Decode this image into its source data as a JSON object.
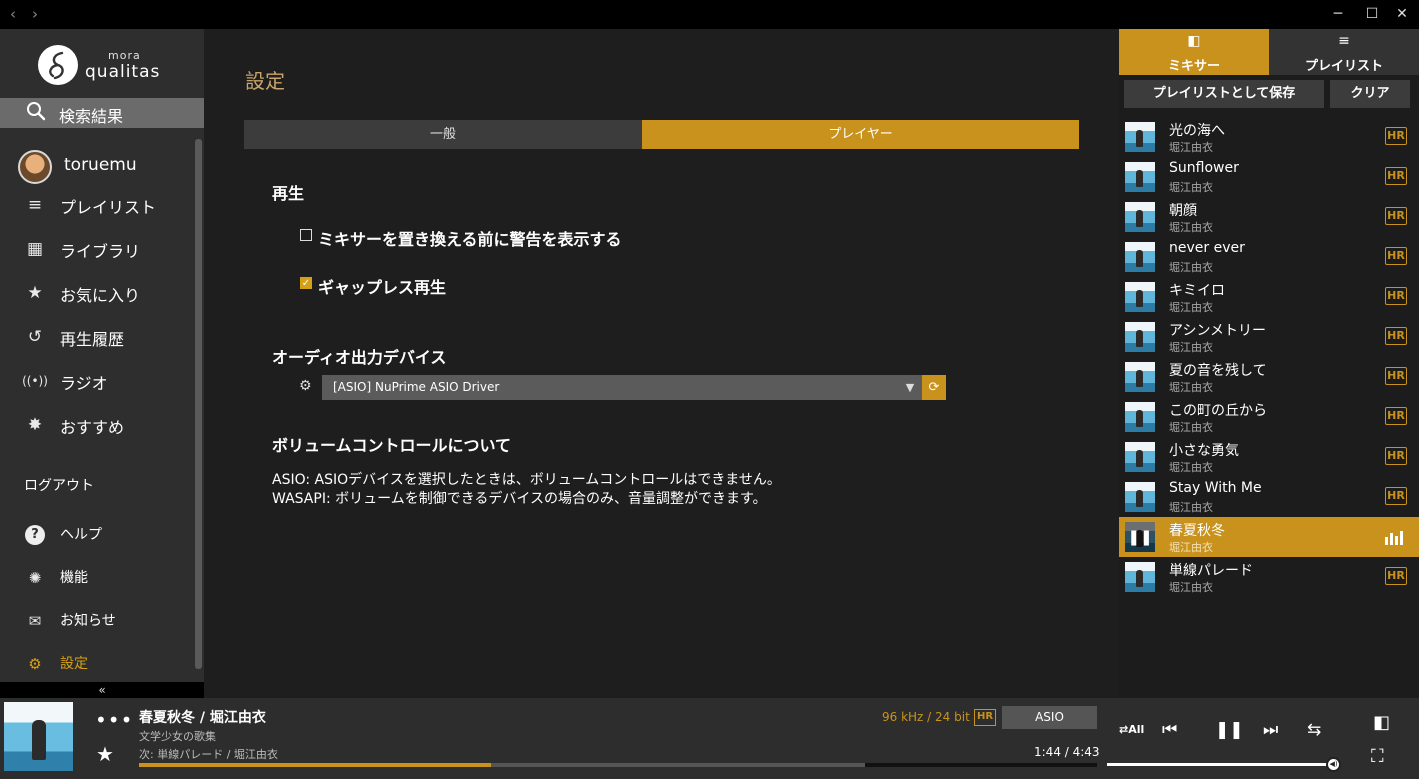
{
  "titlebar": {
    "back_icon": "‹",
    "forward_icon": "›",
    "minimize_icon": "─",
    "maximize_icon": "☐",
    "close_icon": "✕"
  },
  "sidebar": {
    "logo_small": "mora",
    "logo_large": "qualitas",
    "search_label": "検索結果",
    "username": "toruemu",
    "items": [
      {
        "label": "プレイリスト",
        "icon": "≡"
      },
      {
        "label": "ライブラリ",
        "icon": "▦"
      },
      {
        "label": "お気に入り",
        "icon": "★"
      },
      {
        "label": "再生履歴",
        "icon": "↺"
      },
      {
        "label": "ラジオ",
        "icon": "((•))"
      },
      {
        "label": "おすすめ",
        "icon": "✸"
      }
    ],
    "logout": "ログアウト",
    "sub_items": [
      {
        "label": "ヘルプ",
        "icon": "?"
      },
      {
        "label": "機能",
        "icon": "✺"
      },
      {
        "label": "お知らせ",
        "icon": "✉"
      },
      {
        "label": "設定",
        "icon": "⚙"
      }
    ],
    "collapse_icon": "«"
  },
  "main": {
    "title": "設定",
    "tabs": {
      "general": "一般",
      "player": "プレイヤー"
    },
    "playback_heading": "再生",
    "option_warn": "ミキサーを置き換える前に警告を表示する",
    "option_warn_checked": false,
    "option_gapless": "ギャップレス再生",
    "option_gapless_checked": true,
    "check_mark": "✓",
    "audio_heading": "オーディオ出力デバイス",
    "device_value": "[ASIO] NuPrime ASIO Driver",
    "device_arrow": "▼",
    "device_refresh": "⟳",
    "gear": "⚙",
    "volume_heading": "ボリュームコントロールについて",
    "note1": "ASIO: ASIOデバイスを選択したときは、ボリュームコントロールはできません。",
    "note2": "WASAPI: ボリュームを制御できるデバイスの場合のみ、音量調整ができます。"
  },
  "rpanel": {
    "tab_mixer": "ミキサー",
    "tab_mixer_icon": "◧",
    "tab_playlist": "プレイリスト",
    "tab_playlist_icon": "≡",
    "save_btn": "プレイリストとして保存",
    "clear_btn": "クリア",
    "hr_badge": "HR",
    "pause_glyph": "❚❚",
    "tracks": [
      {
        "title": "光の海へ",
        "artist": "堀江由衣"
      },
      {
        "title": "Sunflower",
        "artist": "堀江由衣"
      },
      {
        "title": "朝顔",
        "artist": "堀江由衣"
      },
      {
        "title": "never ever",
        "artist": "堀江由衣"
      },
      {
        "title": "キミイロ",
        "artist": "堀江由衣"
      },
      {
        "title": "アシンメトリー",
        "artist": "堀江由衣"
      },
      {
        "title": "夏の音を残して",
        "artist": "堀江由衣"
      },
      {
        "title": "この町の丘から",
        "artist": "堀江由衣"
      },
      {
        "title": "小さな勇気",
        "artist": "堀江由衣"
      },
      {
        "title": "Stay With Me",
        "artist": "堀江由衣"
      },
      {
        "title": "春夏秋冬",
        "artist": "堀江由衣"
      },
      {
        "title": "単線パレード",
        "artist": "堀江由衣"
      }
    ],
    "active_index": 10
  },
  "player": {
    "more_icon": "•••",
    "fav_icon": "★",
    "title": "春夏秋冬 / 堀江由衣",
    "album": "文学少女の歌集",
    "next": "次: 単線パレード / 堀江由衣",
    "format": "96 kHz / 24 bit",
    "hr": "HR",
    "output": "ASIO",
    "time": "1:44 / 4:43",
    "progress": 0.367,
    "buffered": 0.758,
    "volume": 1.0,
    "repeat_all_icon": "⇄All",
    "prev_icon": "⏮",
    "pause_icon": "❚❚",
    "next_icon": "⏭",
    "shuffle_icon": "⇆",
    "view_icon": "◧",
    "fullscreen_icon": "⛶",
    "volume_icon": "◀)"
  },
  "colors": {
    "accent": "#c8921c",
    "title_gold": "#c9a468"
  }
}
